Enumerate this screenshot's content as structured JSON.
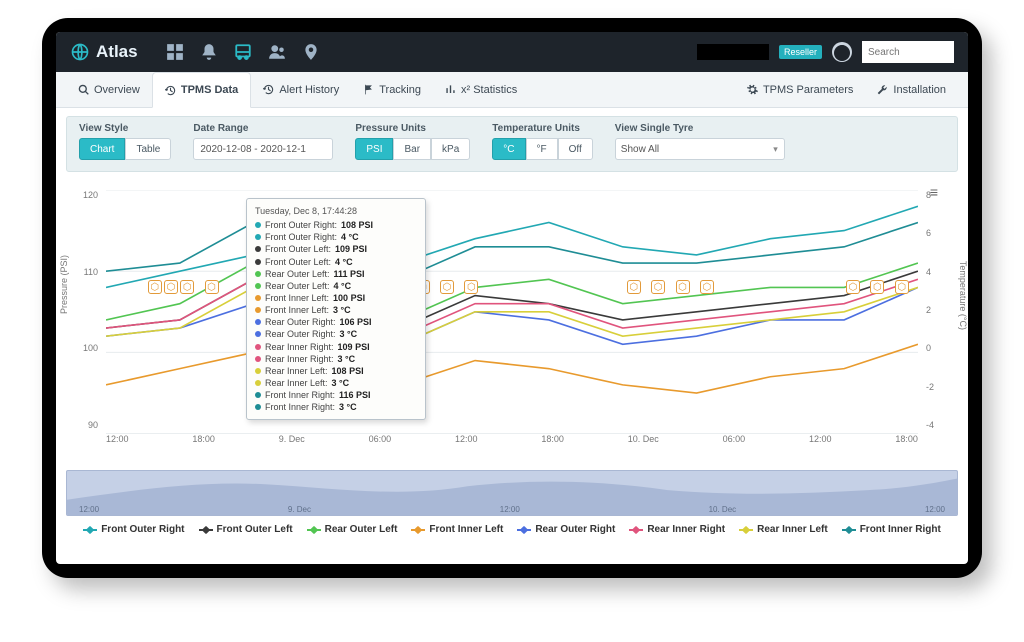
{
  "brand": {
    "title": "Atlas"
  },
  "nav": {
    "icons": [
      "dashboard",
      "bell",
      "bus",
      "users",
      "pin"
    ],
    "active_icon": "bus",
    "badge": "Reseller",
    "search_placeholder": "Search"
  },
  "tabs": {
    "items": [
      {
        "icon": "search",
        "label": "Overview"
      },
      {
        "icon": "history",
        "label": "TPMS Data"
      },
      {
        "icon": "history",
        "label": "Alert History"
      },
      {
        "icon": "flag",
        "label": "Tracking"
      },
      {
        "icon": "stats",
        "label": "x² Statistics"
      }
    ],
    "active_index": 1,
    "right": [
      {
        "icon": "gear",
        "label": "TPMS Parameters"
      },
      {
        "icon": "wrench",
        "label": "Installation"
      }
    ]
  },
  "filters": {
    "view_style": {
      "label": "View Style",
      "options": [
        "Chart",
        "Table"
      ],
      "selected": "Chart"
    },
    "date_range": {
      "label": "Date Range",
      "value": "2020-12-08 - 2020-12-1"
    },
    "pressure_units": {
      "label": "Pressure Units",
      "options": [
        "PSI",
        "Bar",
        "kPa"
      ],
      "selected": "PSI"
    },
    "temp_units": {
      "label": "Temperature Units",
      "options": [
        "°C",
        "°F",
        "Off"
      ],
      "selected": "°C"
    },
    "single_tyre": {
      "label": "View Single Tyre",
      "selected": "Show All"
    }
  },
  "chart_data": {
    "type": "line",
    "x_ticks": [
      "12:00",
      "18:00",
      "9. Dec",
      "06:00",
      "12:00",
      "18:00",
      "10. Dec",
      "06:00",
      "12:00",
      "18:00"
    ],
    "y_left": {
      "label": "Pressure (PSI)",
      "ticks": [
        120,
        110,
        100,
        90
      ]
    },
    "y_right": {
      "label": "Temperature (°C)",
      "ticks": [
        8,
        6,
        4,
        2,
        0,
        -2,
        -4
      ]
    },
    "series": [
      {
        "name": "Front Outer Right",
        "color": "#22a8b3",
        "points": [
          108,
          110,
          112,
          113,
          111,
          114,
          116,
          113,
          112,
          114,
          115,
          118
        ]
      },
      {
        "name": "Front Outer Left",
        "color": "#3a3a3a",
        "points": [
          103,
          104,
          109,
          105,
          103,
          107,
          106,
          104,
          105,
          106,
          107,
          110
        ]
      },
      {
        "name": "Rear Outer Left",
        "color": "#52c552",
        "points": [
          104,
          106,
          111,
          107,
          104,
          108,
          109,
          106,
          107,
          108,
          108,
          111
        ]
      },
      {
        "name": "Front Inner Left",
        "color": "#e89a2d",
        "points": [
          96,
          98,
          100,
          97,
          96,
          99,
          98,
          96,
          95,
          97,
          98,
          101
        ]
      },
      {
        "name": "Rear Outer Right",
        "color": "#4c6fe0",
        "points": [
          102,
          103,
          106,
          104,
          101,
          105,
          104,
          101,
          102,
          104,
          104,
          108
        ]
      },
      {
        "name": "Rear Inner Right",
        "color": "#e0547d",
        "points": [
          103,
          104,
          109,
          105,
          102,
          106,
          106,
          103,
          104,
          105,
          106,
          109
        ]
      },
      {
        "name": "Rear Inner Left",
        "color": "#d8cf3a",
        "points": [
          102,
          103,
          108,
          104,
          101,
          105,
          105,
          102,
          103,
          104,
          105,
          108
        ]
      },
      {
        "name": "Front Inner Right",
        "color": "#1f8d95",
        "points": [
          110,
          111,
          116,
          112,
          109,
          113,
          113,
          111,
          111,
          112,
          113,
          116
        ]
      }
    ],
    "alert_positions_pct": [
      6,
      8,
      10,
      13,
      33,
      36,
      39,
      42,
      45,
      65,
      68,
      71,
      74,
      92,
      95,
      98
    ]
  },
  "tooltip": {
    "heading": "Tuesday, Dec 8, 17:44:28",
    "rows": [
      {
        "color": "#22a8b3",
        "label": "Front Outer Right:",
        "value": "108 PSI"
      },
      {
        "color": "#22a8b3",
        "label": "Front Outer Right:",
        "value": "4 °C"
      },
      {
        "color": "#3a3a3a",
        "label": "Front Outer Left:",
        "value": "109 PSI"
      },
      {
        "color": "#3a3a3a",
        "label": "Front Outer Left:",
        "value": "4 °C"
      },
      {
        "color": "#52c552",
        "label": "Rear Outer Left:",
        "value": "111 PSI"
      },
      {
        "color": "#52c552",
        "label": "Rear Outer Left:",
        "value": "4 °C"
      },
      {
        "color": "#e89a2d",
        "label": "Front Inner Left:",
        "value": "100 PSI"
      },
      {
        "color": "#e89a2d",
        "label": "Front Inner Left:",
        "value": "3 °C"
      },
      {
        "color": "#4c6fe0",
        "label": "Rear Outer Right:",
        "value": "106 PSI"
      },
      {
        "color": "#4c6fe0",
        "label": "Rear Outer Right:",
        "value": "3 °C"
      },
      {
        "color": "#e0547d",
        "label": "Rear Inner Right:",
        "value": "109 PSI"
      },
      {
        "color": "#e0547d",
        "label": "Rear Inner Right:",
        "value": "3 °C"
      },
      {
        "color": "#d8cf3a",
        "label": "Rear Inner Left:",
        "value": "108 PSI"
      },
      {
        "color": "#d8cf3a",
        "label": "Rear Inner Left:",
        "value": "3 °C"
      },
      {
        "color": "#1f8d95",
        "label": "Front Inner Right:",
        "value": "116 PSI"
      },
      {
        "color": "#1f8d95",
        "label": "Front Inner Right:",
        "value": "3 °C"
      }
    ]
  },
  "navigator": {
    "ticks": [
      "12:00",
      "9. Dec",
      "12:00",
      "10. Dec",
      "12:00"
    ]
  }
}
